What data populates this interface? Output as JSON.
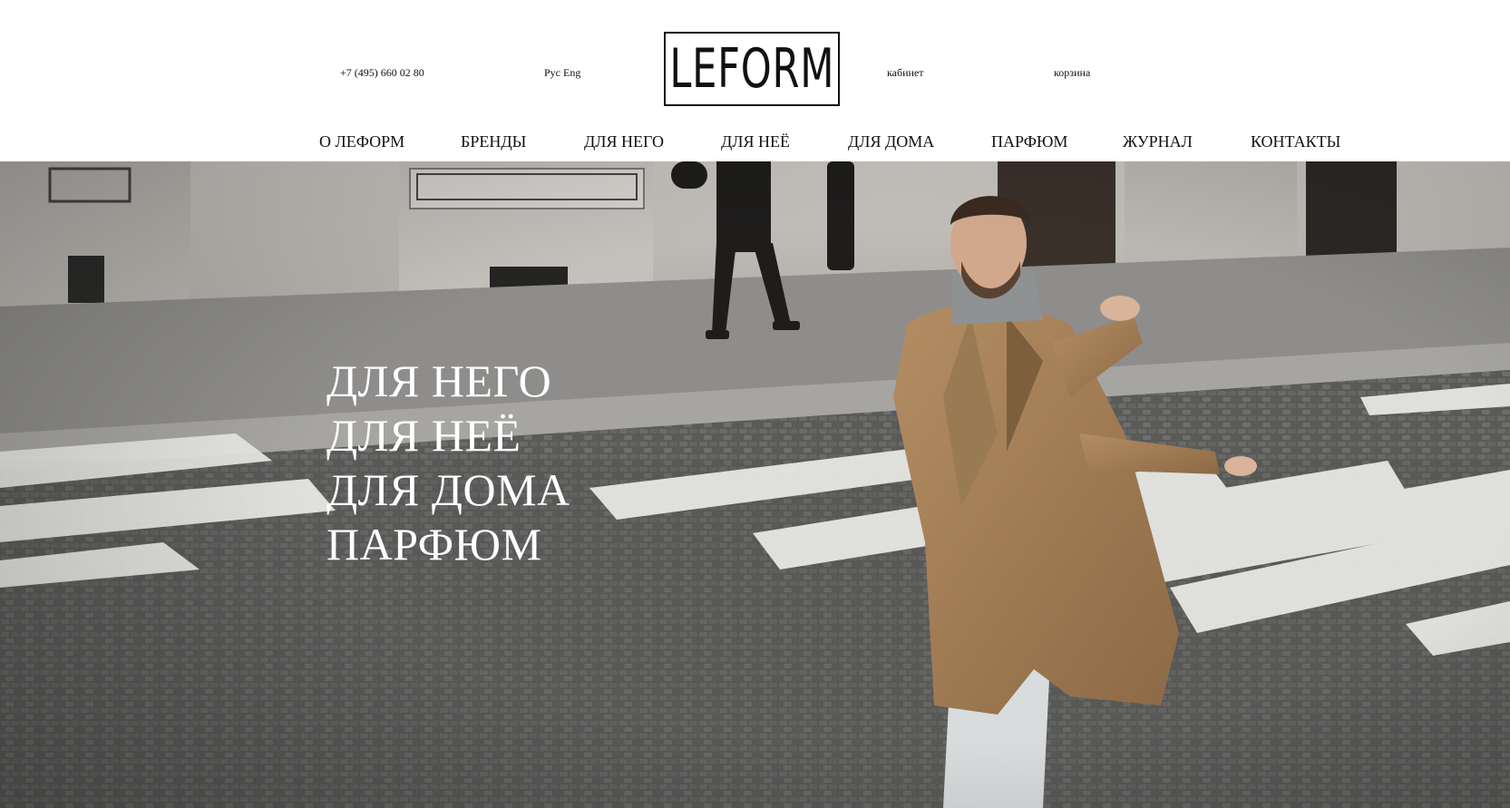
{
  "header": {
    "phone": "+7 (495) 660 02 80",
    "lang_ru": "Рус",
    "lang_en": "Eng",
    "logo": "LEFORM",
    "cabinet": "кабинет",
    "cart": "корзина"
  },
  "nav": {
    "items": [
      "О ЛЕФОРМ",
      "БРЕНДЫ",
      "ДЛЯ НЕГО",
      "ДЛЯ НЕЁ",
      "ДЛЯ ДОМА",
      "ПАРФЮМ",
      "ЖУРНАЛ",
      "КОНТАКТЫ"
    ]
  },
  "hero": {
    "links": [
      "ДЛЯ НЕГО",
      "ДЛЯ НЕЁ",
      "ДЛЯ ДОМА",
      "ПАРФЮМ"
    ]
  }
}
